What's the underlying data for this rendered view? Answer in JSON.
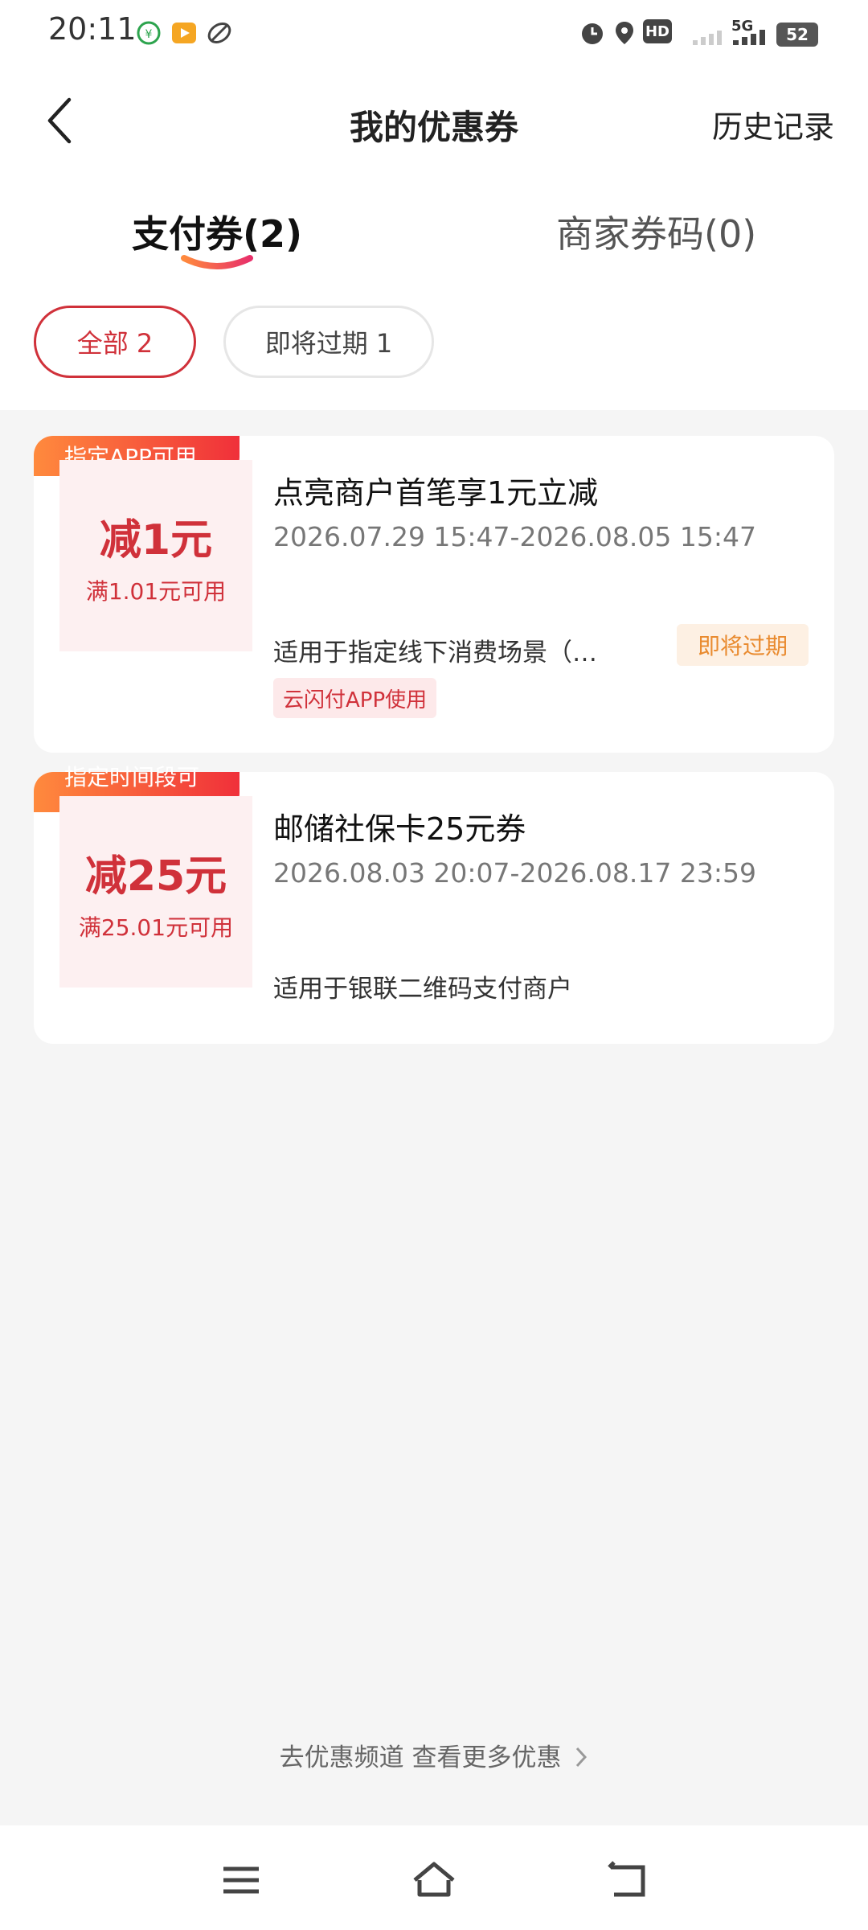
{
  "status": {
    "time": "20:11",
    "network": "5G",
    "hd": "HD",
    "battery": "52"
  },
  "header": {
    "title": "我的优惠券",
    "history": "历史记录"
  },
  "tabs": [
    {
      "label": "支付券(2)",
      "active": true
    },
    {
      "label": "商家券码(0)",
      "active": false
    }
  ],
  "filters": [
    {
      "label": "全部 2",
      "active": true
    },
    {
      "label": "即将过期 1",
      "active": false
    }
  ],
  "coupons": [
    {
      "ribbon": "指定APP可用",
      "amount": "减1元",
      "condition": "满1.01元可用",
      "title": "点亮商户首笔享1元立减",
      "date": "2026.07.29 15:47-2026.08.05 15:47",
      "desc": "适用于指定线下消费场景（…",
      "tag": "云闪付APP使用",
      "badge": "即将过期"
    },
    {
      "ribbon": "指定时间段可用",
      "amount": "减25元",
      "condition": "满25.01元可用",
      "title": "邮储社保卡25元券",
      "date": "2026.08.03 20:07-2026.08.17 23:59",
      "desc": "适用于银联二维码支付商户"
    }
  ],
  "footer_link": "去优惠频道 查看更多优惠",
  "colors": {
    "accent": "#d0313a",
    "warning": "#e98a2e",
    "background": "#f5f5f5"
  },
  "icons": [
    "back-icon",
    "chevron-right-icon",
    "menu-icon",
    "home-icon",
    "return-icon",
    "alarm-icon",
    "location-icon"
  ]
}
